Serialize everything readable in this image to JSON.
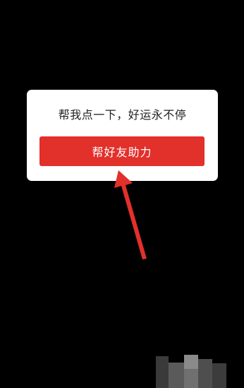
{
  "dialog": {
    "message": "帮我点一下，好运永不停",
    "button_label": "帮好友助力"
  },
  "colors": {
    "background": "#000000",
    "dialog": "#ffffff",
    "button": "#e2302b",
    "arrow": "#e2302b"
  },
  "icons": {
    "pointer": "red-arrow-icon"
  }
}
